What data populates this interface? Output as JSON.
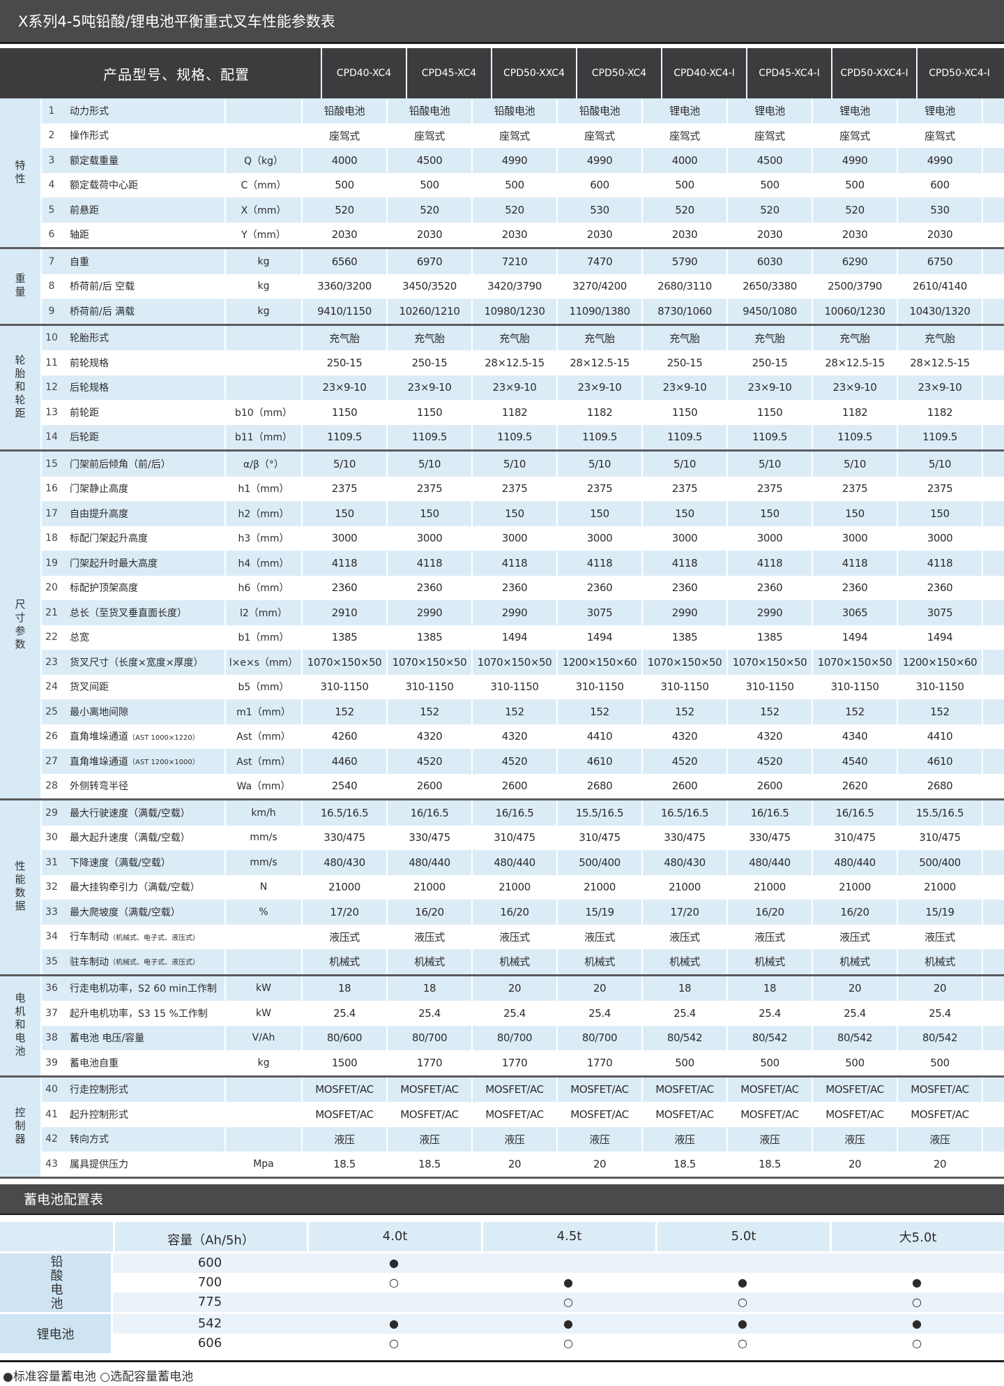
{
  "title": "X系列4-5吨铅酸/锂电池平衡重式叉车性能参数表",
  "header_label": "产品型号、规格、配置",
  "models": [
    "CPD40-XC4",
    "CPD45-XC4",
    "CPD50-XXC4",
    "CPD50-XC4",
    "CPD40-XC4-I",
    "CPD45-XC4-I",
    "CPD50-XXC4-I",
    "CPD50-XC4-I"
  ],
  "groups": [
    {
      "label": "特性",
      "rows": [
        {
          "no": "1",
          "name": "动力形式",
          "unit": "",
          "values": [
            "铅酸电池",
            "铅酸电池",
            "铅酸电池",
            "铅酸电池",
            "锂电池",
            "锂电池",
            "锂电池",
            "锂电池"
          ]
        },
        {
          "no": "2",
          "name": "操作形式",
          "unit": "",
          "values": [
            "座驾式",
            "座驾式",
            "座驾式",
            "座驾式",
            "座驾式",
            "座驾式",
            "座驾式",
            "座驾式"
          ]
        },
        {
          "no": "3",
          "name": "额定载重量",
          "unit": "Q（kg）",
          "values": [
            "4000",
            "4500",
            "4990",
            "4990",
            "4000",
            "4500",
            "4990",
            "4990"
          ]
        },
        {
          "no": "4",
          "name": "额定载荷中心距",
          "unit": "C（mm）",
          "values": [
            "500",
            "500",
            "500",
            "600",
            "500",
            "500",
            "500",
            "600"
          ]
        },
        {
          "no": "5",
          "name": "前悬距",
          "unit": "X（mm）",
          "values": [
            "520",
            "520",
            "520",
            "530",
            "520",
            "520",
            "520",
            "530"
          ]
        },
        {
          "no": "6",
          "name": "轴距",
          "unit": "Y（mm）",
          "values": [
            "2030",
            "2030",
            "2030",
            "2030",
            "2030",
            "2030",
            "2030",
            "2030"
          ]
        }
      ]
    },
    {
      "label": "重量",
      "rows": [
        {
          "no": "7",
          "name": "自重",
          "unit": "kg",
          "values": [
            "6560",
            "6970",
            "7210",
            "7470",
            "5790",
            "6030",
            "6290",
            "6750"
          ]
        },
        {
          "no": "8",
          "name": "桥荷前/后 空载",
          "unit": "kg",
          "values": [
            "3360/3200",
            "3450/3520",
            "3420/3790",
            "3270/4200",
            "2680/3110",
            "2650/3380",
            "2500/3790",
            "2610/4140"
          ]
        },
        {
          "no": "9",
          "name": "桥荷前/后  满载",
          "unit": "kg",
          "values": [
            "9410/1150",
            "10260/1210",
            "10980/1230",
            "11090/1380",
            "8730/1060",
            "9450/1080",
            "10060/1230",
            "10430/1320"
          ]
        }
      ]
    },
    {
      "label": "轮胎和轮距",
      "rows": [
        {
          "no": "10",
          "name": "轮胎形式",
          "unit": "",
          "values": [
            "充气胎",
            "充气胎",
            "充气胎",
            "充气胎",
            "充气胎",
            "充气胎",
            "充气胎",
            "充气胎"
          ]
        },
        {
          "no": "11",
          "name": "前轮规格",
          "unit": "",
          "values": [
            "250-15",
            "250-15",
            "28×12.5-15",
            "28×12.5-15",
            "250-15",
            "250-15",
            "28×12.5-15",
            "28×12.5-15"
          ]
        },
        {
          "no": "12",
          "name": "后轮规格",
          "unit": "",
          "values": [
            "23×9-10",
            "23×9-10",
            "23×9-10",
            "23×9-10",
            "23×9-10",
            "23×9-10",
            "23×9-10",
            "23×9-10"
          ]
        },
        {
          "no": "13",
          "name": "前轮距",
          "unit": "b10（mm）",
          "values": [
            "1150",
            "1150",
            "1182",
            "1182",
            "1150",
            "1150",
            "1182",
            "1182"
          ]
        },
        {
          "no": "14",
          "name": "后轮距",
          "unit": "b11（mm）",
          "values": [
            "1109.5",
            "1109.5",
            "1109.5",
            "1109.5",
            "1109.5",
            "1109.5",
            "1109.5",
            "1109.5"
          ]
        }
      ]
    },
    {
      "label": "尺寸参数",
      "rows": [
        {
          "no": "15",
          "name": "门架前后倾角（前/后）",
          "unit": "α/β（°）",
          "values": [
            "5/10",
            "5/10",
            "5/10",
            "5/10",
            "5/10",
            "5/10",
            "5/10",
            "5/10"
          ]
        },
        {
          "no": "16",
          "name": "门架静止高度",
          "unit": "h1（mm）",
          "values": [
            "2375",
            "2375",
            "2375",
            "2375",
            "2375",
            "2375",
            "2375",
            "2375"
          ]
        },
        {
          "no": "17",
          "name": "自由提升高度",
          "unit": "h2（mm）",
          "values": [
            "150",
            "150",
            "150",
            "150",
            "150",
            "150",
            "150",
            "150"
          ]
        },
        {
          "no": "18",
          "name": "标配门架起升高度",
          "unit": "h3（mm）",
          "values": [
            "3000",
            "3000",
            "3000",
            "3000",
            "3000",
            "3000",
            "3000",
            "3000"
          ]
        },
        {
          "no": "19",
          "name": "门架起升时最大高度",
          "unit": "h4（mm）",
          "values": [
            "4118",
            "4118",
            "4118",
            "4118",
            "4118",
            "4118",
            "4118",
            "4118"
          ]
        },
        {
          "no": "20",
          "name": "标配护顶架高度",
          "unit": "h6（mm）",
          "values": [
            "2360",
            "2360",
            "2360",
            "2360",
            "2360",
            "2360",
            "2360",
            "2360"
          ]
        },
        {
          "no": "21",
          "name": "总长（至货叉垂直面长度）",
          "unit": "l2（mm）",
          "values": [
            "2910",
            "2990",
            "2990",
            "3075",
            "2990",
            "2990",
            "3065",
            "3075"
          ]
        },
        {
          "no": "22",
          "name": "总宽",
          "unit": "b1（mm）",
          "values": [
            "1385",
            "1385",
            "1494",
            "1494",
            "1385",
            "1385",
            "1494",
            "1494"
          ]
        },
        {
          "no": "23",
          "name": "货叉尺寸（长度×宽度×厚度）",
          "unit": "l×e×s（mm）",
          "values": [
            "1070×150×50",
            "1070×150×50",
            "1070×150×50",
            "1200×150×60",
            "1070×150×50",
            "1070×150×50",
            "1070×150×50",
            "1200×150×60"
          ]
        },
        {
          "no": "24",
          "name": "货叉间距",
          "unit": "b5（mm）",
          "values": [
            "310-1150",
            "310-1150",
            "310-1150",
            "310-1150",
            "310-1150",
            "310-1150",
            "310-1150",
            "310-1150"
          ]
        },
        {
          "no": "25",
          "name": "最小离地间隙",
          "unit": "m1（mm）",
          "values": [
            "152",
            "152",
            "152",
            "152",
            "152",
            "152",
            "152",
            "152"
          ]
        },
        {
          "no": "26",
          "name": "直角堆垛通道",
          "name_sm": "（AST 1000×1220）",
          "unit": "Ast（mm）",
          "values": [
            "4260",
            "4320",
            "4320",
            "4410",
            "4320",
            "4320",
            "4340",
            "4410"
          ]
        },
        {
          "no": "27",
          "name": "直角堆垛通道",
          "name_sm": "（AST 1200×1000）",
          "unit": "Ast（mm）",
          "values": [
            "4460",
            "4520",
            "4520",
            "4610",
            "4520",
            "4520",
            "4540",
            "4610"
          ]
        },
        {
          "no": "28",
          "name": "外侧转弯半径",
          "unit": "Wa（mm）",
          "values": [
            "2540",
            "2600",
            "2600",
            "2680",
            "2600",
            "2600",
            "2620",
            "2680"
          ]
        }
      ]
    },
    {
      "label": "性能数据",
      "rows": [
        {
          "no": "29",
          "name": "最大行驶速度（满载/空载）",
          "unit": "km/h",
          "values": [
            "16.5/16.5",
            "16/16.5",
            "16/16.5",
            "15.5/16.5",
            "16.5/16.5",
            "16/16.5",
            "16/16.5",
            "15.5/16.5"
          ]
        },
        {
          "no": "30",
          "name": "最大起升速度（满载/空载）",
          "unit": "mm/s",
          "values": [
            "330/475",
            "330/475",
            "310/475",
            "310/475",
            "330/475",
            "330/475",
            "310/475",
            "310/475"
          ]
        },
        {
          "no": "31",
          "name": "下降速度（满载/空载）",
          "unit": "mm/s",
          "values": [
            "480/430",
            "480/440",
            "480/440",
            "500/400",
            "480/430",
            "480/440",
            "480/440",
            "500/400"
          ]
        },
        {
          "no": "32",
          "name": "最大挂钩牵引力（满载/空载）",
          "unit": "N",
          "values": [
            "21000",
            "21000",
            "21000",
            "21000",
            "21000",
            "21000",
            "21000",
            "21000"
          ]
        },
        {
          "no": "33",
          "name": "最大爬坡度（满载/空载）",
          "unit": "%",
          "values": [
            "17/20",
            "16/20",
            "16/20",
            "15/19",
            "17/20",
            "16/20",
            "16/20",
            "15/19"
          ]
        },
        {
          "no": "34",
          "name": "行车制动",
          "name_sm": "（机械式、电子式、液压式）",
          "unit": "",
          "values": [
            "液压式",
            "液压式",
            "液压式",
            "液压式",
            "液压式",
            "液压式",
            "液压式",
            "液压式"
          ]
        },
        {
          "no": "35",
          "name": "驻车制动",
          "name_sm": "（机械式、电子式、液压式）",
          "unit": "",
          "values": [
            "机械式",
            "机械式",
            "机械式",
            "机械式",
            "机械式",
            "机械式",
            "机械式",
            "机械式"
          ]
        }
      ]
    },
    {
      "label": "电机和电池",
      "rows": [
        {
          "no": "36",
          "name": "行走电机功率，S2 60 min工作制",
          "unit": "kW",
          "values": [
            "18",
            "18",
            "20",
            "20",
            "18",
            "18",
            "20",
            "20"
          ]
        },
        {
          "no": "37",
          "name": "起升电机功率，S3 15 %工作制",
          "unit": "kW",
          "values": [
            "25.4",
            "25.4",
            "25.4",
            "25.4",
            "25.4",
            "25.4",
            "25.4",
            "25.4"
          ]
        },
        {
          "no": "38",
          "name": "蓄电池 电压/容量",
          "unit": "V/Ah",
          "values": [
            "80/600",
            "80/700",
            "80/700",
            "80/700",
            "80/542",
            "80/542",
            "80/542",
            "80/542"
          ]
        },
        {
          "no": "39",
          "name": "蓄电池自重",
          "unit": "kg",
          "values": [
            "1500",
            "1770",
            "1770",
            "1770",
            "500",
            "500",
            "500",
            "500"
          ]
        }
      ]
    },
    {
      "label": "控制器",
      "rows": [
        {
          "no": "40",
          "name": "行走控制形式",
          "unit": "",
          "values": [
            "MOSFET/AC",
            "MOSFET/AC",
            "MOSFET/AC",
            "MOSFET/AC",
            "MOSFET/AC",
            "MOSFET/AC",
            "MOSFET/AC",
            "MOSFET/AC"
          ]
        },
        {
          "no": "41",
          "name": "起升控制形式",
          "unit": "",
          "values": [
            "MOSFET/AC",
            "MOSFET/AC",
            "MOSFET/AC",
            "MOSFET/AC",
            "MOSFET/AC",
            "MOSFET/AC",
            "MOSFET/AC",
            "MOSFET/AC"
          ]
        },
        {
          "no": "42",
          "name": "转向方式",
          "unit": "",
          "values": [
            "液压",
            "液压",
            "液压",
            "液压",
            "液压",
            "液压",
            "液压",
            "液压"
          ]
        },
        {
          "no": "43",
          "name": "属具提供压力",
          "unit": "Mpa",
          "values": [
            "18.5",
            "18.5",
            "20",
            "20",
            "18.5",
            "18.5",
            "20",
            "20"
          ]
        }
      ]
    }
  ],
  "battery": {
    "title": "蓄电池配置表",
    "capacity_label": "容量（Ah/5h）",
    "tonnages": [
      "4.0t",
      "4.5t",
      "5.0t",
      "大5.0t"
    ],
    "groups": [
      {
        "label": "铅酸电池",
        "vertical": true,
        "rows": [
          {
            "capacity": "600",
            "cells": [
              "●",
              "",
              "",
              ""
            ]
          },
          {
            "capacity": "700",
            "cells": [
              "○",
              "●",
              "●",
              "●"
            ]
          },
          {
            "capacity": "775",
            "cells": [
              "",
              "○",
              "○",
              "○"
            ]
          }
        ]
      },
      {
        "label": "锂电池",
        "vertical": false,
        "rows": [
          {
            "capacity": "542",
            "cells": [
              "●",
              "●",
              "●",
              "●"
            ]
          },
          {
            "capacity": "606",
            "cells": [
              "○",
              "○",
              "○",
              "○"
            ]
          }
        ]
      }
    ],
    "footnote": "●标准容量蓄电池 ○选配容量蓄电池"
  }
}
